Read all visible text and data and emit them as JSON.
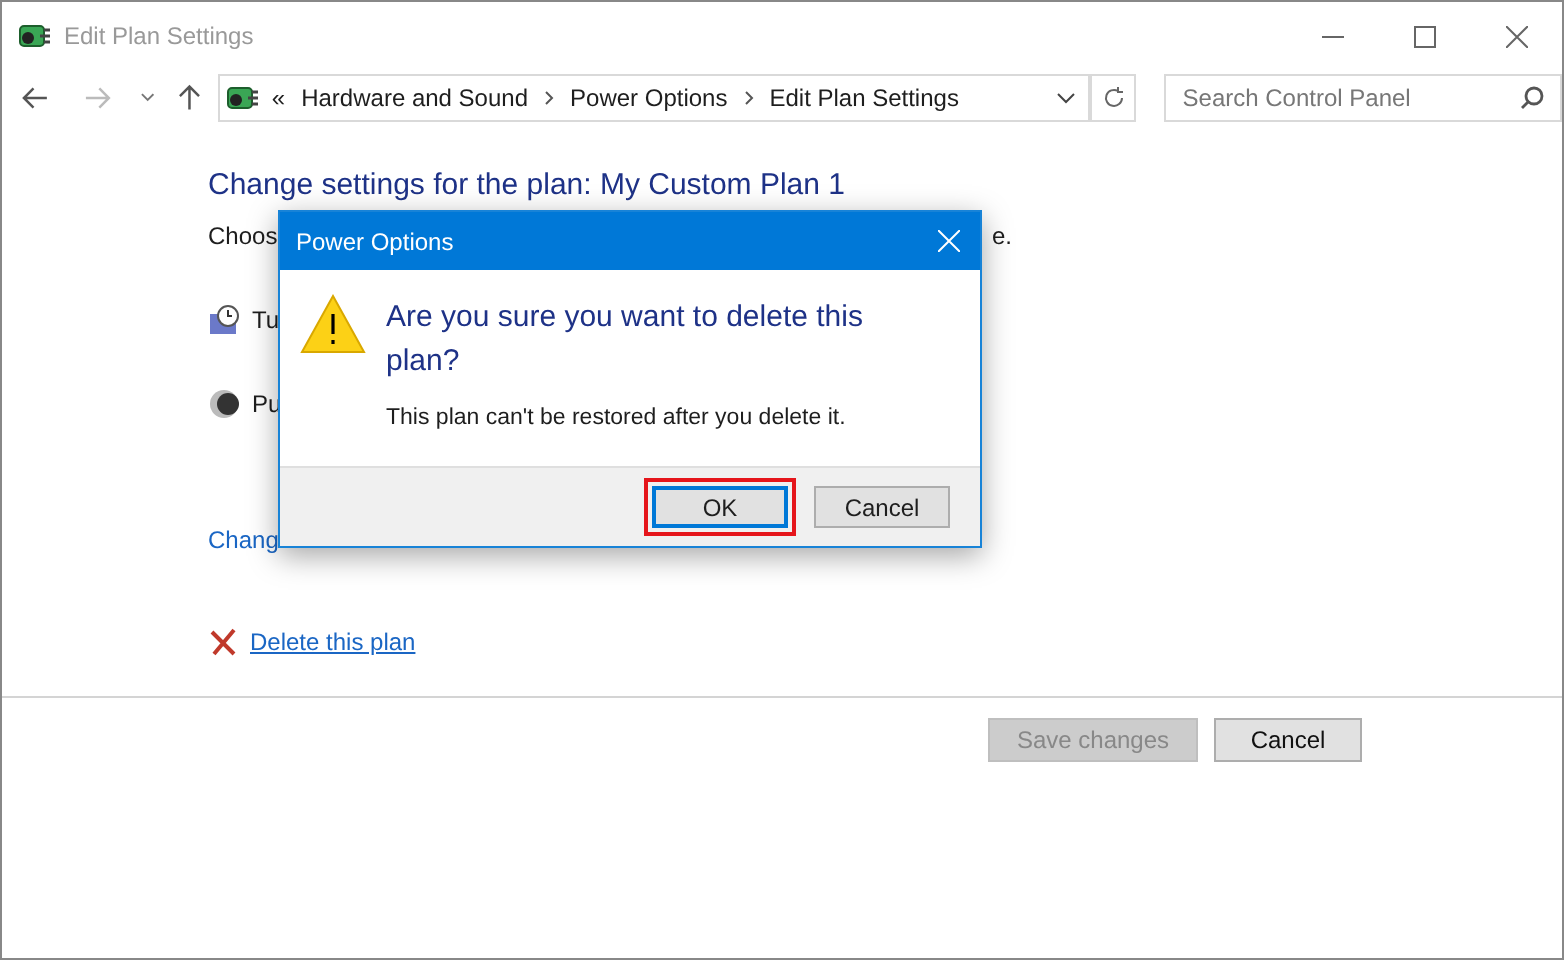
{
  "window": {
    "title": "Edit Plan Settings"
  },
  "address_bar": {
    "overflow": "«",
    "crumbs": [
      "Hardware and Sound",
      "Power Options",
      "Edit Plan Settings"
    ]
  },
  "search": {
    "placeholder": "Search Control Panel"
  },
  "page": {
    "heading": "Change settings for the plan: My Custom Plan 1",
    "subtitle_start": "Choos",
    "subtitle_end": "e.",
    "rows": [
      "Tu",
      "Pu"
    ],
    "advanced_link": "Chang",
    "delete_link": "Delete this plan"
  },
  "footer_buttons": [
    {
      "label": "Save changes",
      "disabled": true
    },
    {
      "label": "Cancel",
      "disabled": false
    }
  ],
  "dialog": {
    "title": "Power Options",
    "question": "Are you sure you want to delete this plan?",
    "message": "This plan can't be restored after you delete it.",
    "buttons": [
      {
        "label": "OK",
        "selected": true
      },
      {
        "label": "Cancel",
        "selected": false
      }
    ]
  }
}
